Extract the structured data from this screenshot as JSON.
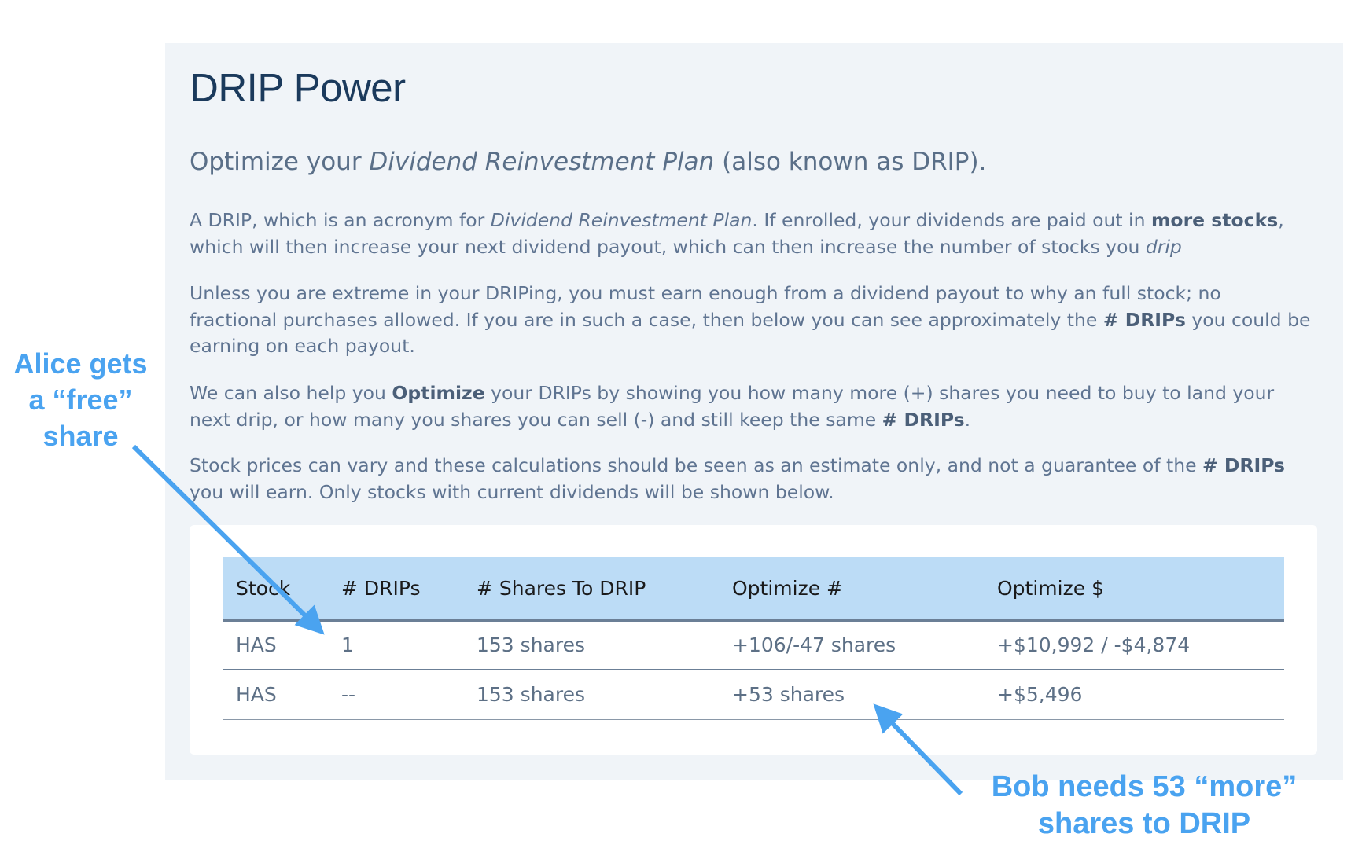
{
  "title": "DRIP Power",
  "subtitle": {
    "prefix": "Optimize your ",
    "emph": "Dividend Reinvestment Plan",
    "suffix": " (also known as DRIP)."
  },
  "paragraphs": {
    "p1": {
      "a": "A DRIP, which is an acronym for ",
      "emph": "Dividend Reinvestment Plan",
      "b": ". If enrolled, your dividends are paid out in ",
      "strong": "more stocks",
      "c": ", which will then increase your next dividend payout, which can then increase the number of stocks you ",
      "emph2": "drip"
    },
    "p2": {
      "a": "Unless you are extreme in your DRIPing, you must earn enough from a dividend payout to why an full stock; no fractional purchases allowed. If you are in such a case, then below you can see approximately the ",
      "strong": "# DRIPs",
      "b": " you could be earning on each payout."
    },
    "p3": {
      "a": "We can also help you ",
      "strong": "Optimize",
      "b": " your DRIPs by showing you how many more (+) shares you need to buy to land your next drip, or how many you shares you can sell (-) and still keep the same ",
      "strong2": "# DRIPs",
      "c": "."
    },
    "p4": {
      "a": "Stock prices can vary and these calculations should be seen as an estimate only, and not a guarantee of the ",
      "strong": "# DRIPs",
      "b": " you will earn. Only stocks with current dividends will be shown below."
    }
  },
  "table": {
    "headers": [
      "Stock",
      "# DRIPs",
      "# Shares To DRIP",
      "Optimize #",
      "Optimize $"
    ],
    "rows": [
      [
        "HAS",
        "1",
        "153 shares",
        "+106/-47 shares",
        "+$10,992 / -$4,874"
      ],
      [
        "HAS",
        "--",
        "153 shares",
        "+53 shares",
        "+$5,496"
      ]
    ]
  },
  "annotations": {
    "alice": [
      "Alice gets",
      "a “free”",
      "share"
    ],
    "bob": [
      "Bob needs 53 “more”",
      "shares to DRIP"
    ]
  },
  "colors": {
    "annotation": "#4aa3f0",
    "header_bg": "#bcdcf6",
    "panel_bg": "#f0f4f8",
    "title": "#1b3a5c"
  }
}
